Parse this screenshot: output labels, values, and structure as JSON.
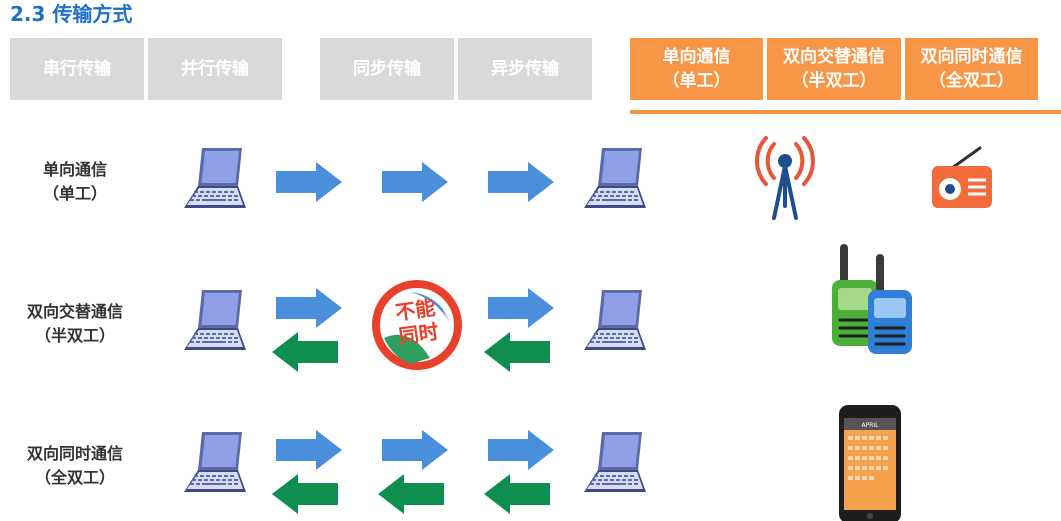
{
  "title": "2.3 传输方式",
  "tabs": {
    "serial": "串行传输",
    "parallel": "并行传输",
    "sync": "同步传输",
    "async": "异步传输",
    "simplex_line1": "单向通信",
    "simplex_line2": "（单工）",
    "half_line1": "双向交替通信",
    "half_line2": "（半双工）",
    "full_line1": "双向同时通信",
    "full_line2": "（全双工）"
  },
  "rows": {
    "simplex_line1": "单向通信",
    "simplex_line2": "（单工）",
    "half_line1": "双向交替通信",
    "half_line2": "（半双工）",
    "full_line1": "双向同时通信",
    "full_line2": "（全双工）"
  },
  "no_sign": {
    "line1": "不能",
    "line2": "同时"
  },
  "phone_header": "APRIL",
  "colors": {
    "title": "#1d6fc9",
    "tab_gray": "#d9d9d9",
    "tab_orange": "#f79646",
    "arrow_blue": "#4a8fdc",
    "arrow_green": "#0f8f4e",
    "laptop_screen": "#7b8fd9"
  },
  "icons": [
    "laptop-icon",
    "antenna-icon",
    "radio-icon",
    "walkie-talkie-icon",
    "smartphone-icon",
    "no-entry-icon"
  ]
}
